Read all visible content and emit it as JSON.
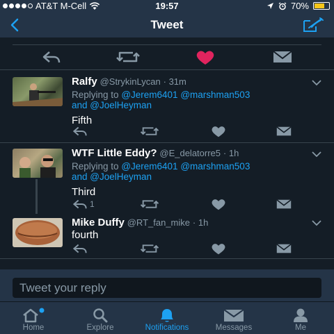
{
  "status_bar": {
    "carrier": "AT&T M-Cell",
    "time": "19:57",
    "battery": "70%",
    "battery_level": 0.7
  },
  "nav": {
    "title": "Tweet",
    "back_icon": "chevron-left-icon",
    "compose_icon": "compose-icon"
  },
  "main_actions": {
    "icons": [
      "reply-icon",
      "retweet-icon",
      "heart-icon",
      "dm-icon"
    ],
    "liked": true,
    "like_color": "#e0245e"
  },
  "tweets": [
    {
      "name": "Ralfy",
      "handle": "@StrykinLycan",
      "time": "31m",
      "replying_prefix": "Replying to",
      "mention_1": "@Jerem6401",
      "mention_2": "@marshman503",
      "and": "and",
      "mention_3": "@JoelHeyman",
      "text": "Fifth",
      "reply_count": ""
    },
    {
      "name": "WTF Little Eddy?",
      "handle": "@E_delatorre5",
      "time": "1h",
      "replying_prefix": "Replying to",
      "mention_1": "@Jerem6401",
      "mention_2": "@marshman503",
      "and": "and",
      "mention_3": "@JoelHeyman",
      "text": "Third",
      "reply_count": "1"
    },
    {
      "name": "Mike Duffy",
      "handle": "@RT_fan_mike",
      "time": "1h",
      "text": "fourth",
      "reply_count": ""
    }
  ],
  "reply_bar": {
    "placeholder": "Tweet your reply"
  },
  "tabs": [
    {
      "label": "Home",
      "icon": "home-icon",
      "badge": true
    },
    {
      "label": "Explore",
      "icon": "search-icon"
    },
    {
      "label": "Notifications",
      "icon": "bell-icon",
      "active": true
    },
    {
      "label": "Messages",
      "icon": "envelope-icon"
    },
    {
      "label": "Me",
      "icon": "person-icon"
    }
  ],
  "colors": {
    "accent": "#1da1f2",
    "muted": "#8899a6",
    "background": "#141d26",
    "bar": "#243447"
  }
}
